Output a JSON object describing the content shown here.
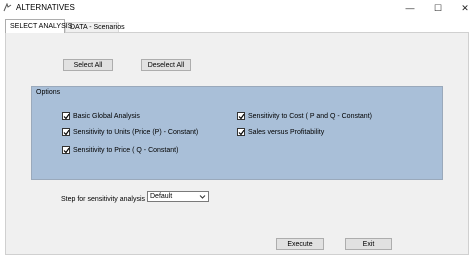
{
  "window": {
    "title": "ALTERNATIVES",
    "minimize_glyph": "—",
    "maximize_glyph": "☐",
    "close_glyph": "✕"
  },
  "tabs": [
    {
      "label": "SELECT ANALYSIS",
      "active": true
    },
    {
      "label": "DATA - Scenarios",
      "active": false
    }
  ],
  "buttons": {
    "select_all": "Select All",
    "deselect_all": "Deselect All",
    "execute": "Execute",
    "exit": "Exit"
  },
  "options": {
    "title": "Options",
    "items": [
      {
        "label": "Basic Global Analysis",
        "checked": true
      },
      {
        "label": "Sensitivity to Units (Price (P) -  Constant)",
        "checked": true
      },
      {
        "label": "Sensitivity to Price ( Q - Constant)",
        "checked": true
      },
      {
        "label": "Sensitivity to Cost ( P and Q - Constant)",
        "checked": true
      },
      {
        "label": "Sales versus Profitability",
        "checked": true
      }
    ]
  },
  "step": {
    "label": "Step for sensitivity analysis",
    "selected": "Default"
  },
  "colors": {
    "options_background": "#a9bfd8",
    "form_background": "#f0f0f0"
  },
  "icons": {
    "app": "app-icon",
    "check": "checkmark-icon",
    "dropdown": "chevron-down-icon"
  }
}
